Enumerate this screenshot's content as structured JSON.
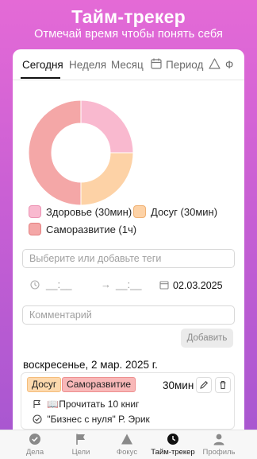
{
  "header": {
    "title": "Тайм-трекер",
    "subtitle": "Отмечай время чтобы понять себя"
  },
  "tabs": [
    {
      "label": "Сегодня",
      "active": true
    },
    {
      "label": "Неделя",
      "active": false
    },
    {
      "label": "Месяц",
      "active": false
    },
    {
      "label": "Период",
      "active": false,
      "icon": "calendar-icon"
    },
    {
      "label": "Ф",
      "active": false,
      "icon": "triangle-icon"
    }
  ],
  "chart_data": {
    "type": "pie",
    "categories": [
      "Здоровье (30мин)",
      "Досуг (30мин)",
      "Саморазвитие (1ч)"
    ],
    "values": [
      30,
      30,
      60
    ],
    "colors": [
      "#f9b9cf",
      "#fdd2a6",
      "#f4a7a7"
    ]
  },
  "legend": [
    {
      "label": "Здоровье (30мин)",
      "color": "#f9b9cf"
    },
    {
      "label": "Досуг (30мин)",
      "color": "#fdd2a6"
    },
    {
      "label": "Саморазвитие (1ч)",
      "color": "#f4a7a7"
    }
  ],
  "form": {
    "tags_placeholder": "Выберите или добавьте теги",
    "start_time": "__:__",
    "end_time": "__:__",
    "date": "02.03.2025",
    "comment_placeholder": "Комментарий",
    "add_label": "Добавить"
  },
  "day": {
    "title": "воскресенье, 2 мар. 2025 г.",
    "entry": {
      "tags": [
        {
          "label": "Досуг",
          "bg": "#fdd9ad",
          "border": "#f5bd7c"
        },
        {
          "label": "Саморазвитие",
          "bg": "#f8b8b8",
          "border": "#ee8f8f"
        }
      ],
      "duration": "30мин",
      "items": [
        {
          "text": "📖Прочитать 10 книг",
          "icon": "flag-icon"
        },
        {
          "text": "\"Бизнес с нуля\" Р. Эрик",
          "icon": "check-circle-icon"
        }
      ]
    }
  },
  "nav": [
    {
      "label": "Дела",
      "icon": "check-circle-icon",
      "active": false
    },
    {
      "label": "Цели",
      "icon": "flag-icon",
      "active": false
    },
    {
      "label": "Фокус",
      "icon": "triangle-icon",
      "active": false
    },
    {
      "label": "Тайм-трекер",
      "icon": "clock-icon",
      "active": true
    },
    {
      "label": "Профиль",
      "icon": "person-icon",
      "active": false
    }
  ]
}
